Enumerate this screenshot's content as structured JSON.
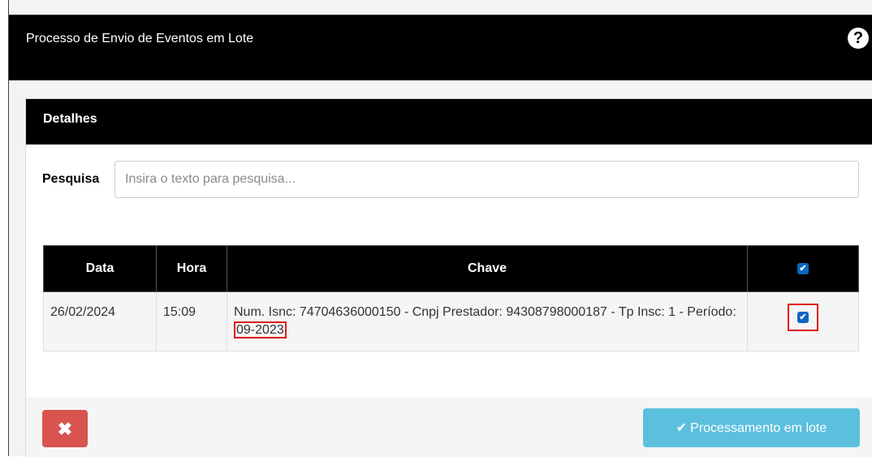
{
  "modal": {
    "title": "Processo de Envio de Eventos em Lote",
    "help_icon_glyph": "?"
  },
  "panel": {
    "title": "Detalhes"
  },
  "search": {
    "label": "Pesquisa",
    "placeholder": "Insira o texto para pesquisa..."
  },
  "table": {
    "headers": {
      "data": "Data",
      "hora": "Hora",
      "chave": "Chave",
      "select_all_checked": true
    },
    "rows": [
      {
        "data": "26/02/2024",
        "hora": "15:09",
        "chave_prefix": "Num. Isnc: 74704636000150 - Cnpj Prestador: 94308798000187 - Tp Insc: 1 - Período: ",
        "chave_period": "09-2023",
        "checked": true
      }
    ]
  },
  "footer": {
    "cancel_glyph": "✖",
    "batch_glyph": "✔",
    "batch_label": "Processamento em lote"
  },
  "colors": {
    "header_bg": "#000000",
    "cancel_button": "#d9534f",
    "batch_button": "#5bc0de",
    "checkbox": "#0a66c2",
    "highlight": "#e0181b"
  },
  "icons": {
    "help": "question-circle-icon",
    "cancel": "x-icon",
    "batch": "check-icon",
    "checkbox": "checkbox-checked-icon"
  }
}
